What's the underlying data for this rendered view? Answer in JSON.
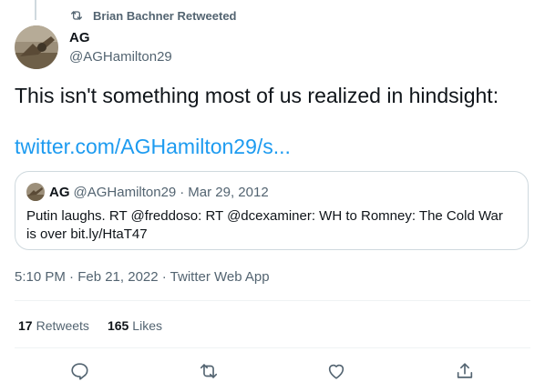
{
  "retweet_bar": {
    "text": "Brian Bachner Retweeted",
    "icon": "retweet-icon"
  },
  "author": {
    "name": "AG",
    "handle": "@AGHamilton29",
    "avatar": "avatar-image"
  },
  "tweet": {
    "text": "This isn't something most of us realized in hindsight:",
    "link": "twitter.com/AGHamilton29/s..."
  },
  "quote": {
    "name": "AG",
    "handle": "@AGHamilton29",
    "separator": "·",
    "date": "Mar 29, 2012",
    "text": "Putin laughs. RT @freddoso: RT @dcexaminer: WH to Romney: The Cold War is over bit.ly/HtaT47"
  },
  "timestamp": "5:10 PM · Feb 21, 2022 · Twitter Web App",
  "stats": {
    "retweets_count": "17",
    "retweets_label": "Retweets",
    "likes_count": "165",
    "likes_label": "Likes"
  },
  "actions": [
    "reply-icon",
    "retweet-icon",
    "like-icon",
    "share-icon"
  ],
  "colors": {
    "link": "#1d9bf0",
    "secondary_text": "#536471",
    "primary_text": "#0f1419",
    "border": "#cfd9de"
  }
}
